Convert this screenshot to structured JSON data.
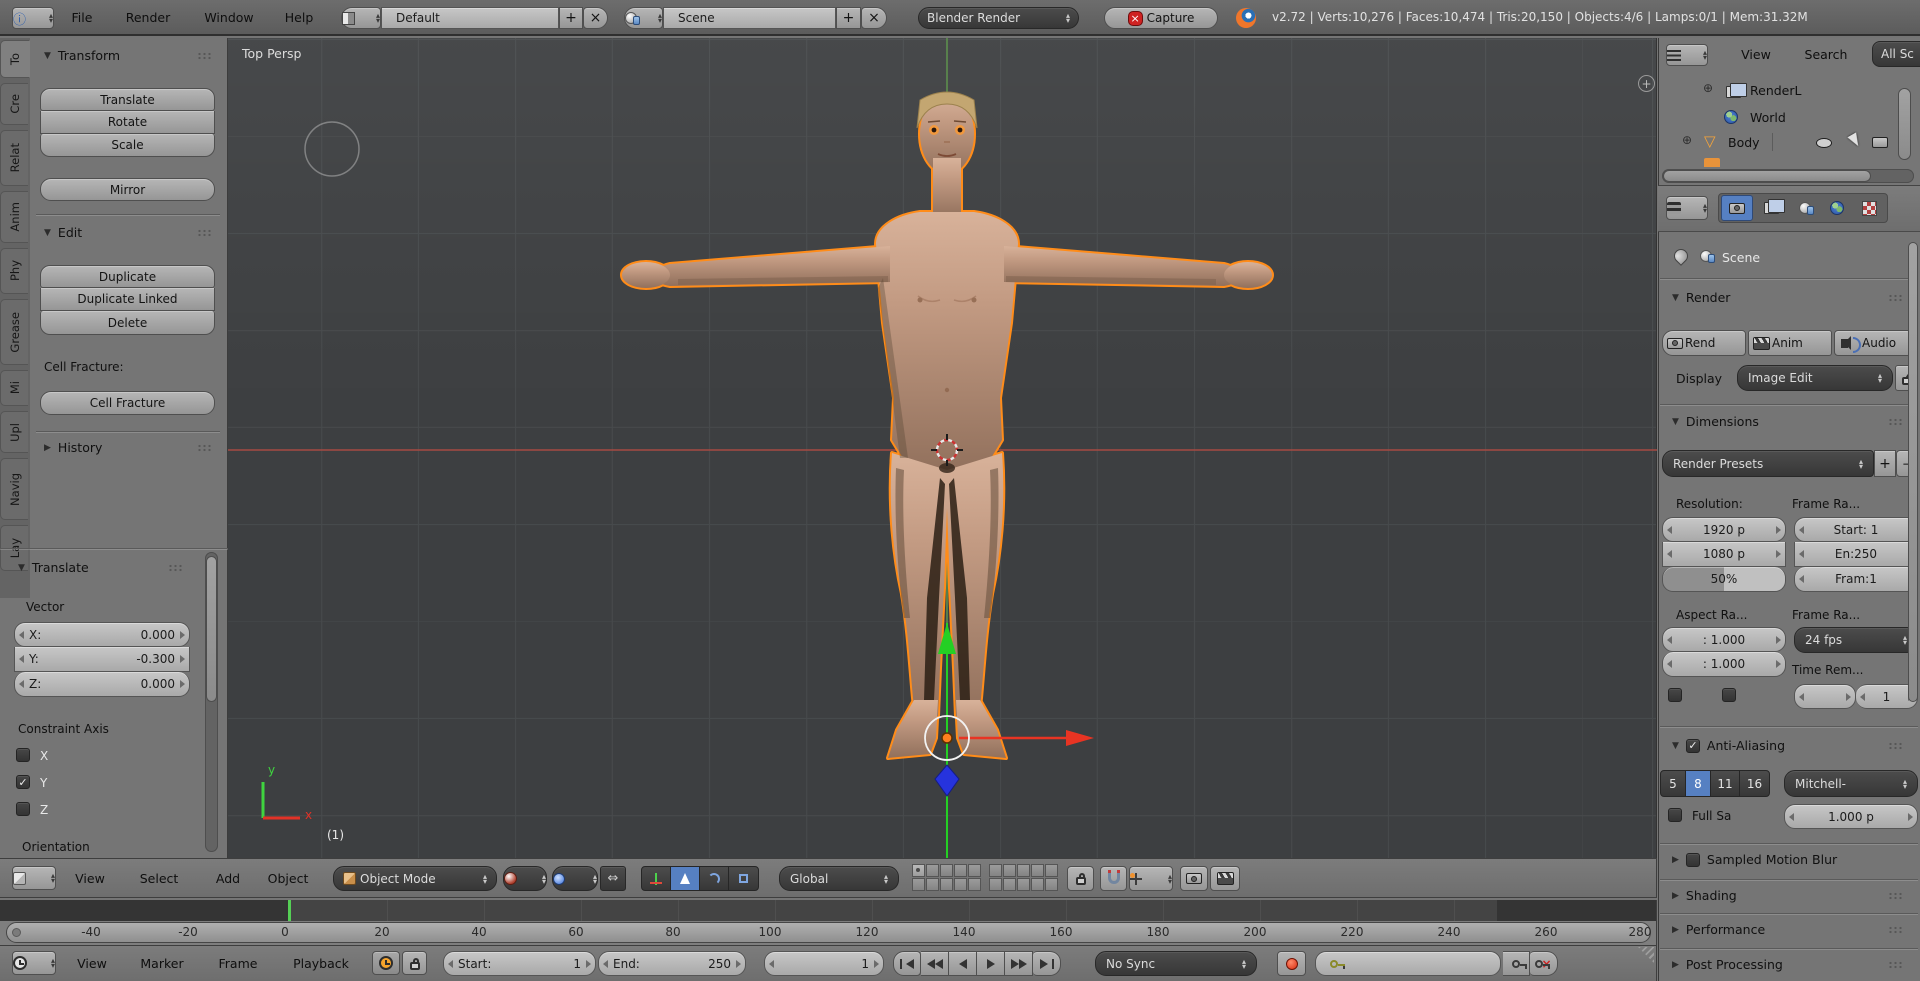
{
  "icons": {
    "tri_down": "▼",
    "tri_right": "▶",
    "check": "✓",
    "plus": "+",
    "close": "×",
    "expand": "⊕",
    "mesh_triangle": "▽",
    "info": "ⓘ",
    "up": "▴",
    "down": "▾"
  },
  "colors": {
    "accent_blue": "#5680c2",
    "selection_orange": "#ff8c19",
    "axis_red": "#b34b42",
    "axis_green": "#6aa05a",
    "gizmo_green": "#24d024",
    "gizmo_red": "#e83423",
    "gizmo_blue": "#2633dd",
    "playhead_green": "#55cf55"
  },
  "topbar": {
    "menus": [
      "File",
      "Render",
      "Window",
      "Help"
    ],
    "layout_name": "Default",
    "scene_name": "Scene",
    "engine": "Blender Render",
    "capture_label": "Capture",
    "stats": "v2.72 | Verts:10,276 | Faces:10,474 | Tris:20,150 | Objects:4/6 | Lamps:0/1 | Mem:31.32M"
  },
  "toolshelf": {
    "tabs": [
      "To",
      "Cre",
      "Relat",
      "Anim",
      "Phy",
      "Grease",
      "Mi",
      "Upl",
      "Navig",
      "Lay"
    ],
    "active_tab": "To",
    "transform": {
      "title": "Transform",
      "buttons": [
        "Translate",
        "Rotate",
        "Scale"
      ],
      "mirror": "Mirror"
    },
    "edit": {
      "title": "Edit",
      "buttons": [
        "Duplicate",
        "Duplicate Linked",
        "Delete"
      ],
      "cell_fracture_label": "Cell Fracture:",
      "cell_fracture_button": "Cell Fracture"
    },
    "history_title": "History"
  },
  "operator_panel": {
    "title": "Translate",
    "vector_label": "Vector",
    "fields": [
      {
        "label": "X:",
        "value": "0.000"
      },
      {
        "label": "Y:",
        "value": "-0.300"
      },
      {
        "label": "Z:",
        "value": "0.000"
      }
    ],
    "constraint_axis_label": "Constraint Axis",
    "axes": [
      {
        "label": "X",
        "checked": false
      },
      {
        "label": "Y",
        "checked": true
      },
      {
        "label": "Z",
        "checked": false
      }
    ],
    "orientation_label": "Orientation"
  },
  "viewport": {
    "view_label": "Top Persp",
    "frame_label": "(1)",
    "axis_x": "x",
    "axis_y": "y"
  },
  "viewport_header": {
    "menus": [
      "View",
      "Select",
      "Add",
      "Object"
    ],
    "mode": "Object Mode",
    "orientation": "Global"
  },
  "timeline": {
    "menus": [
      "View",
      "Marker",
      "Frame",
      "Playback"
    ],
    "ticks": [
      "-40",
      "-20",
      "0",
      "20",
      "40",
      "60",
      "80",
      "100",
      "120",
      "140",
      "160",
      "180",
      "200",
      "220",
      "240",
      "260",
      "280"
    ],
    "start_label": "Start:",
    "start_value": "1",
    "end_label": "End:",
    "end_value": "250",
    "current_frame": "1",
    "sync_mode": "No Sync"
  },
  "outliner": {
    "menus": [
      "View",
      "Search"
    ],
    "scope": "All Sc",
    "items": [
      {
        "label": "RenderL"
      },
      {
        "label": "World"
      },
      {
        "label": "Body"
      }
    ]
  },
  "properties": {
    "context_name": "Scene",
    "render": {
      "title": "Render",
      "buttons": [
        "Rend",
        "Anim",
        "Audio"
      ],
      "display_label": "Display",
      "display_value": "Image Edit"
    },
    "dimensions": {
      "title": "Dimensions",
      "presets_label": "Render Presets",
      "resolution_label": "Resolution:",
      "frame_range_label": "Frame Ra...",
      "res_x": "1920 p",
      "res_y": "1080 p",
      "res_pct": "50%",
      "frame_start": "Start: 1",
      "frame_end": "En:250",
      "frame_step": "Fram:1",
      "aspect_label": "Aspect Ra...",
      "aspect_x": ": 1.000",
      "aspect_y": ": 1.000",
      "frame_rate_label": "Frame Ra...",
      "fps": "24 fps",
      "time_remap_label": "Time Rem...",
      "remap_value": "1"
    },
    "antialiasing": {
      "title": "Anti-Aliasing",
      "samples": [
        "5",
        "8",
        "11",
        "16"
      ],
      "active_sample": "8",
      "filter": "Mitchell-",
      "full_sample_label": "Full Sa",
      "filter_size": "1.000 p"
    },
    "collapsed_panels": [
      "Sampled Motion Blur",
      "Shading",
      "Performance",
      "Post Processing"
    ]
  }
}
